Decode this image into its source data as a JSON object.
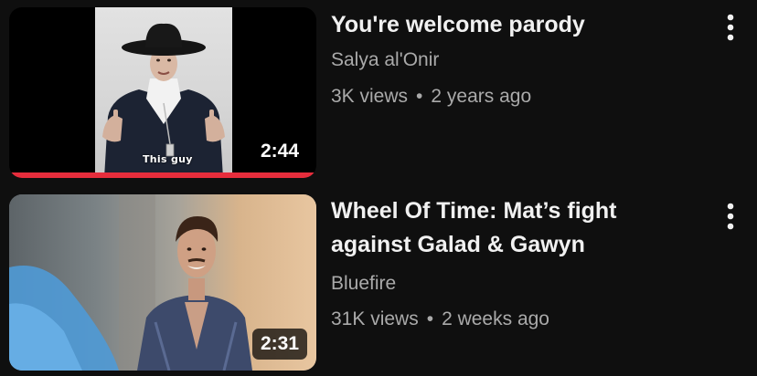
{
  "videos": [
    {
      "title": "You're welcome parody",
      "channel": "Salya al'Onir",
      "views": "3K views",
      "separator": "•",
      "age": "2 years ago",
      "duration": "2:44",
      "caption": "This guy",
      "watched_fraction": 1.0,
      "icons": {
        "menu": "more-vert-icon"
      }
    },
    {
      "title_line1": "Wheel Of Time: Mat’s fight",
      "title_line2": "against Galad & Gawyn",
      "channel": "Bluefire",
      "views": "31K views",
      "separator": "•",
      "age": "2 weeks ago",
      "duration": "2:31",
      "icons": {
        "menu": "more-vert-icon"
      }
    }
  ],
  "colors": {
    "background": "#0f0f0f",
    "title": "#f1f1f1",
    "secondary_text": "#aaaaaa",
    "progress": "#e62d3c"
  }
}
